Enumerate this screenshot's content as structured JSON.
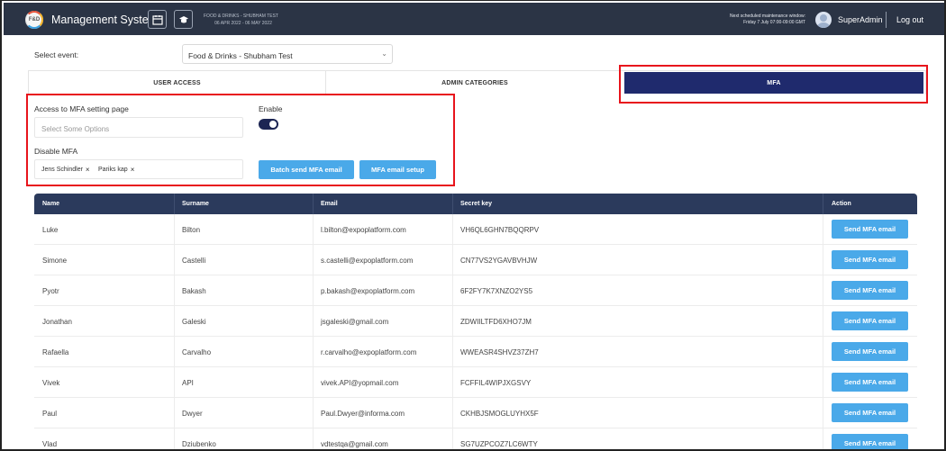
{
  "header": {
    "app_title": "Management System",
    "event_name": "FOOD & DRINKS - SHUBHAM TEST",
    "event_dates": "06 APR 2022 - 06 MAY 2022",
    "maintenance_line1": "Next scheduled maintenance window:",
    "maintenance_line2": "Friday 7 July 07:00-09:00 GMT",
    "user_name": "SuperAdmin",
    "logout_label": "Log out",
    "icons": [
      "logo",
      "calendar-icon",
      "graduation-cap-icon",
      "avatar"
    ]
  },
  "select_event": {
    "label": "Select event:",
    "value": "Food & Drinks - Shubham Test"
  },
  "tabs": [
    {
      "label": "USER ACCESS",
      "active": false
    },
    {
      "label": "ADMIN CATEGORIES",
      "active": false
    },
    {
      "label": "MFA",
      "active": true
    }
  ],
  "mfa_settings": {
    "access_label": "Access to MFA setting page",
    "access_placeholder": "Select Some Options",
    "enable_label": "Enable",
    "enable_value": true,
    "disable_label": "Disable MFA",
    "disable_chips": [
      "Jens Schindler",
      "Pariks kap"
    ],
    "batch_button": "Batch send MFA email",
    "setup_button": "MFA email setup"
  },
  "table": {
    "columns": [
      "Name",
      "Surname",
      "Email",
      "Secret key",
      "Action"
    ],
    "action_label": "Send MFA email",
    "rows": [
      {
        "name": "Luke",
        "surname": "Bilton",
        "email": "l.bilton@expoplatform.com",
        "secret": "VH6QL6GHN7BQQRPV"
      },
      {
        "name": "Simone",
        "surname": "Castelli",
        "email": "s.castelli@expoplatform.com",
        "secret": "CN77VS2YGAVBVHJW"
      },
      {
        "name": "Pyotr",
        "surname": "Bakash",
        "email": "p.bakash@expoplatform.com",
        "secret": "6F2FY7K7XNZO2YS5"
      },
      {
        "name": "Jonathan",
        "surname": "Galeski",
        "email": "jsgaleski@gmail.com",
        "secret": "ZDWIILTFD6XHO7JM"
      },
      {
        "name": "Rafaella",
        "surname": "Carvalho",
        "email": "r.carvalho@expoplatform.com",
        "secret": "WWEASR4SHVZ37ZH7"
      },
      {
        "name": "Vivek",
        "surname": "API",
        "email": "vivek.API@yopmail.com",
        "secret": "FCFFIL4WIPJXGSVY"
      },
      {
        "name": "Paul",
        "surname": "Dwyer",
        "email": "Paul.Dwyer@informa.com",
        "secret": "CKHBJSMOGLUYHX5F"
      },
      {
        "name": "Vlad",
        "surname": "Dziubenko",
        "email": "vdtestqa@gmail.com",
        "secret": "SG7UZPCOZ7LC6WTY"
      }
    ]
  },
  "colors": {
    "header_bg": "#2b3445",
    "active_tab": "#1f2a6d",
    "button_blue": "#4aa9e9",
    "table_header": "#2b3a5c",
    "highlight_red": "#e8141c"
  }
}
